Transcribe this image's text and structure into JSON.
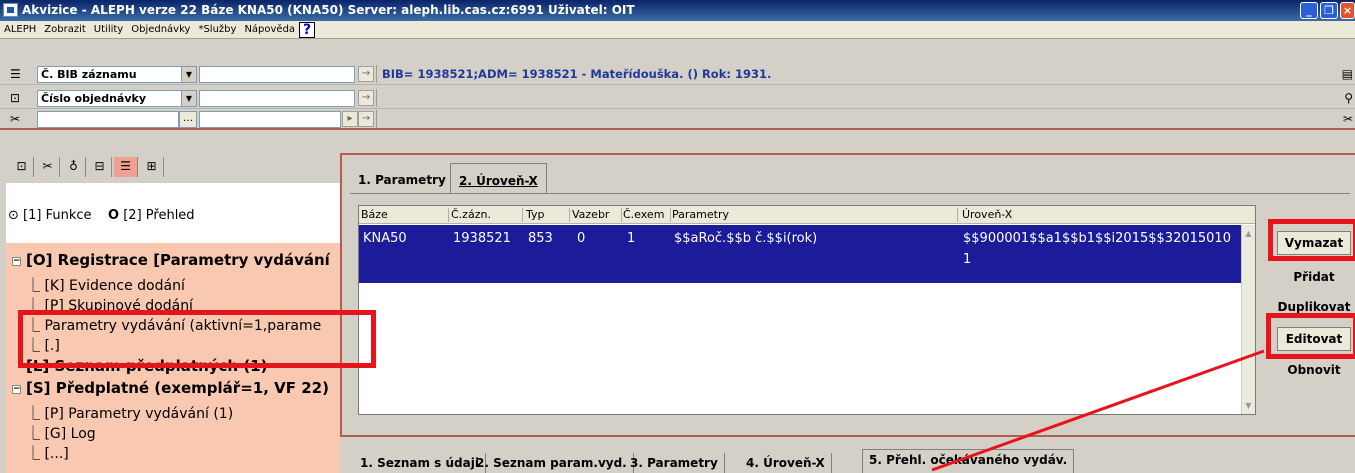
{
  "window": {
    "title": "Akvizice - ALEPH verze 22  Báze KNA50 (KNA50)  Server: aleph.lib.cas.cz:6991  Uživatel: OIT",
    "controls": [
      "_",
      "❐",
      "×"
    ]
  },
  "menu": {
    "items": [
      "ALEPH",
      "Zobrazit",
      "Utility",
      "Objednávky",
      "*Služby",
      "Nápověda"
    ],
    "help": "?"
  },
  "search": {
    "row1": {
      "field": "Č. BIB záznamu",
      "info": "BIB= 1938521;ADM= 1938521 - Mateřídouška. () Rok: 1931."
    },
    "row2": {
      "field": "Číslo objednávky"
    },
    "row3": {
      "ellipsis": "…"
    }
  },
  "left": {
    "radio1": "[1] Funkce",
    "radio2": "[2] Přehled",
    "tree": [
      {
        "label": "[O] Registrace [Parametry vydávání",
        "expander": "−"
      },
      {
        "label": "[K] Evidence dodání"
      },
      {
        "label": "[P] Skupinové dodání"
      },
      {
        "label": "Parametry vydávání (aktivní=1,parame"
      },
      {
        "label": "[.]"
      },
      {
        "label": "[L] Seznam předplatných (1)"
      },
      {
        "label": "[S] Předplatné (exemplář=1, VF 22)",
        "expander": "−"
      },
      {
        "label": "[P] Parametry vydávání (1)"
      },
      {
        "label": "[G] Log"
      },
      {
        "label": "[...]"
      }
    ]
  },
  "tabs": {
    "tab1": "1. Parametry",
    "tab2": "2. Úroveň-X"
  },
  "grid": {
    "headers": [
      "Báze",
      "Č.zázn.",
      "Typ",
      "Vazebr",
      "Č.exem",
      "Parametry",
      "Úroveň-X"
    ],
    "row": {
      "baze": "KNA50",
      "zazn": "1938521",
      "typ": "853",
      "vazebr": "0",
      "exem": "1",
      "parametry": "$$aRoč.$$b č.$$i(rok)",
      "uroven1": "$$900001$$a1$$b1$$i2015$$32015010",
      "uroven2": "1"
    }
  },
  "buttons": {
    "vymazat": "Vymazat",
    "pridat": "Přidat",
    "duplikovat": "Duplikovat",
    "editovat": "Editovat",
    "obnovit": "Obnovit"
  },
  "bottom_tabs": [
    "1. Seznam s údaji",
    "2. Seznam param.vyd.",
    "3. Parametry",
    "4. Úroveň-X",
    "5. Přehl. očekávaného vydáv."
  ]
}
